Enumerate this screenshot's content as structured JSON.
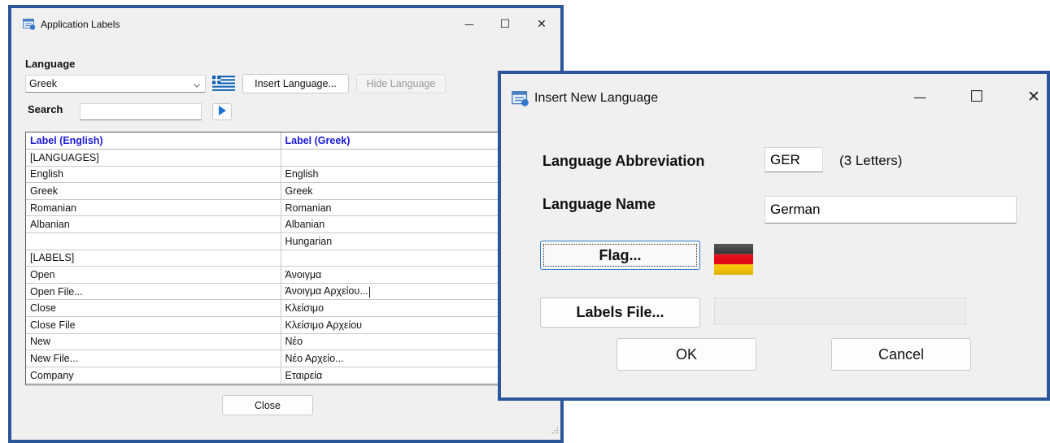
{
  "app_window": {
    "title": "Application Labels",
    "minimize_glyph": "—",
    "maximize_glyph": "☐",
    "close_glyph": "✕",
    "language_label": "Language",
    "language_value": "Greek",
    "dropdown_icon": "chevron-down-icon",
    "flag_icon": "greek-flag-icon",
    "insert_language_label": "Insert Language...",
    "hide_language_label": "Hide Language",
    "search_label": "Search",
    "search_value": "",
    "search_go_icon": "play-arrow-icon",
    "table": {
      "columns": [
        "Label (English)",
        "Label (Greek)"
      ],
      "rows": [
        [
          "[LANGUAGES]",
          ""
        ],
        [
          "English",
          "English"
        ],
        [
          "Greek",
          "Greek"
        ],
        [
          "Romanian",
          "Romanian"
        ],
        [
          "Albanian",
          "Albanian"
        ],
        [
          "",
          "Hungarian"
        ],
        [
          "[LABELS]",
          ""
        ],
        [
          "Open",
          "Άνοιγμα"
        ],
        [
          "Open File...",
          "Άνοιγμα Αρχείου..."
        ],
        [
          "Close",
          "Κλείσιμο"
        ],
        [
          "Close File",
          "Κλείσιμο Αρχείου"
        ],
        [
          "New",
          "Νέο"
        ],
        [
          "New File...",
          "Νέο Αρχείο..."
        ],
        [
          "Company",
          "Εταιρεία"
        ]
      ]
    },
    "close_button_label": "Close"
  },
  "dialog": {
    "title": "Insert New Language",
    "minimize_glyph": "—",
    "maximize_glyph": "☐",
    "close_glyph": "✕",
    "abbreviation_label": "Language Abbreviation",
    "abbreviation_value": "GER",
    "abbreviation_hint": "(3 Letters)",
    "name_label": "Language Name",
    "name_value": "German",
    "flag_button_label": "Flag...",
    "flag_icon": "german-flag-icon",
    "labels_file_button_label": "Labels File...",
    "labels_file_value": "",
    "ok_label": "OK",
    "cancel_label": "Cancel"
  },
  "colors": {
    "window_border": "#2b579a",
    "header_text": "#1a1adb",
    "window_background": "#f0f0f0"
  }
}
